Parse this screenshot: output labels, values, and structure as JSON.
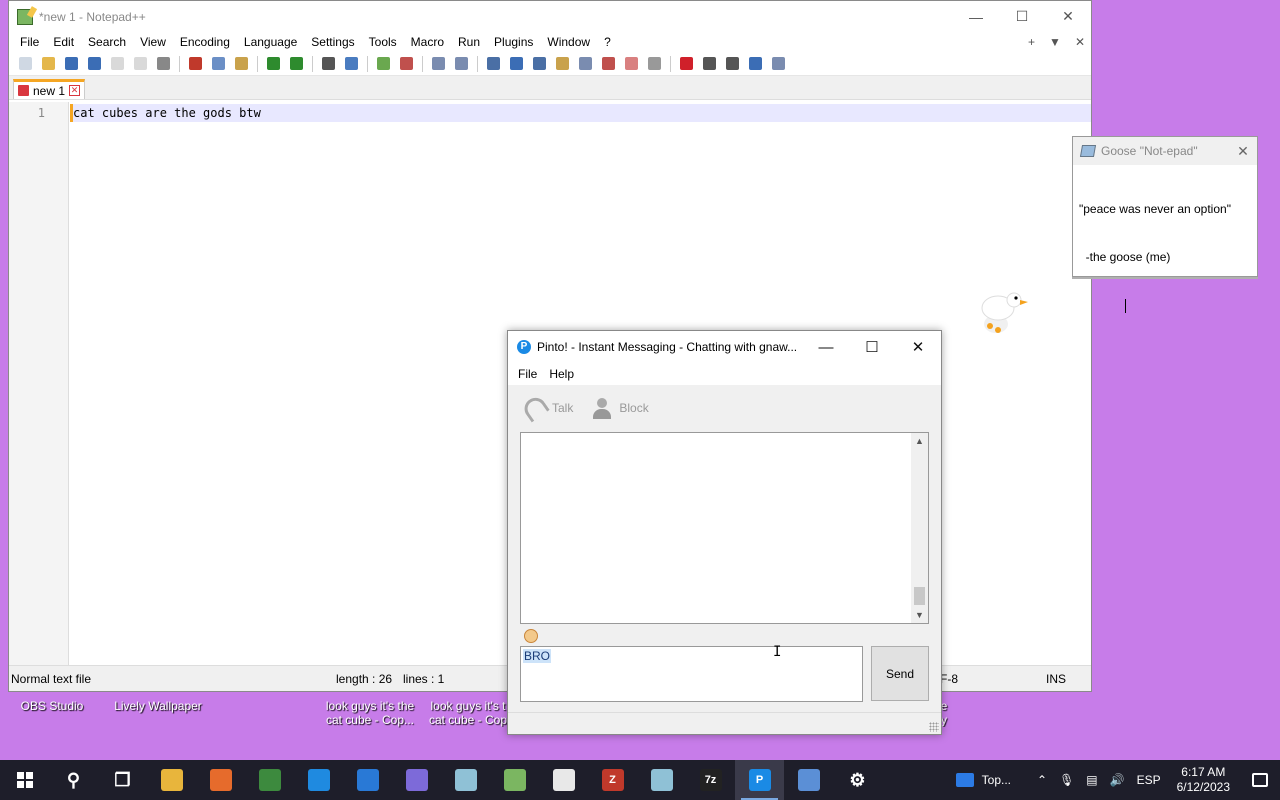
{
  "desktop": {
    "icons": [
      {
        "label": "OBS Studio"
      },
      {
        "label": "Lively Wallpaper"
      },
      {
        "label": "look guys it's the\ncat cube - Cop..."
      },
      {
        "label": "look guys it's t\ncat cube - Cop"
      },
      {
        "label": "e\ny"
      }
    ]
  },
  "notepad": {
    "title": "*new 1 - Notepad++",
    "menu": [
      "File",
      "Edit",
      "Search",
      "View",
      "Encoding",
      "Language",
      "Settings",
      "Tools",
      "Macro",
      "Run",
      "Plugins",
      "Window",
      "?"
    ],
    "menu_right": [
      "+",
      "▼",
      "✕"
    ],
    "tab_label": "new 1",
    "line_number": "1",
    "line_text": "cat cubes are the gods btw",
    "status": {
      "type": "Normal text file",
      "length": "length : 26",
      "lines": "lines : 1",
      "encoding": "F-8",
      "mode": "INS"
    },
    "toolbar_colors": [
      "#cfd8e3",
      "#e4b74b",
      "#3b6db5",
      "#3b6db5",
      "#d9d9d9",
      "#d9d9d9",
      "#888",
      "sep",
      "#c0392b",
      "#6b8fc6",
      "#c9a24c",
      "sep",
      "#2e8b2e",
      "#2e8b2e",
      "sep",
      "#555",
      "#4a7cc0",
      "sep",
      "#6aa84f",
      "#c0504d",
      "sep",
      "#7a8cb0",
      "#7a8cb0",
      "sep",
      "#4a6fa5",
      "#3b6db5",
      "#4a6fa5",
      "#c9a24c",
      "#7a8cb0",
      "#c0504d",
      "#d98080",
      "#999",
      "sep",
      "#d0202a",
      "#555",
      "#555",
      "#3b6db5",
      "#7a8cb0"
    ]
  },
  "goose": {
    "title": "Goose \"Not-epad\"",
    "line1": "\"peace was never an option\"",
    "line2": "  -the goose (me)"
  },
  "pinto": {
    "title": "Pinto! - Instant Messaging - Chatting with gnaw...",
    "menu": [
      "File",
      "Help"
    ],
    "tools": {
      "talk": "Talk",
      "block": "Block"
    },
    "input_value": "BRO",
    "send_label": "Send"
  },
  "taskbar": {
    "apps": [
      {
        "icon": "search-icon",
        "color": "transparent",
        "glyph": "⚲"
      },
      {
        "icon": "task-view-icon",
        "color": "transparent",
        "glyph": "❐"
      },
      {
        "icon": "file-explorer-icon",
        "color": "#e8b53c",
        "glyph": ""
      },
      {
        "icon": "firefox-icon",
        "color": "#e66b2c",
        "glyph": ""
      },
      {
        "icon": "chrome-icon",
        "color": "#3d8a3e",
        "glyph": ""
      },
      {
        "icon": "edge-icon",
        "color": "#1f8ae0",
        "glyph": ""
      },
      {
        "icon": "store-icon",
        "color": "#2979d6",
        "glyph": ""
      },
      {
        "icon": "snipping-icon",
        "color": "#7d6ad9",
        "glyph": ""
      },
      {
        "icon": "notepad-generic-icon",
        "color": "#8fc1d6",
        "glyph": ""
      },
      {
        "icon": "notepadpp-icon",
        "color": "#7bb661",
        "glyph": ""
      },
      {
        "icon": "cube-icon",
        "color": "#e8e8e8",
        "glyph": ""
      },
      {
        "icon": "filezilla-icon",
        "color": "#c0392b",
        "glyph": "Z"
      },
      {
        "icon": "notepad-blue-icon",
        "color": "#8fc1d6",
        "glyph": ""
      },
      {
        "icon": "7zip-icon",
        "color": "#222",
        "glyph": "7z"
      },
      {
        "icon": "pinto-icon",
        "color": "#1a8ae5",
        "glyph": "P"
      },
      {
        "icon": "remote-desktop-icon",
        "color": "#5b8fd6",
        "glyph": ""
      },
      {
        "icon": "settings-icon",
        "color": "transparent",
        "glyph": "⚙"
      }
    ],
    "tray": {
      "widget_label": "Top...",
      "language": "ESP",
      "time": "6:17 AM",
      "date": "6/12/2023"
    }
  }
}
